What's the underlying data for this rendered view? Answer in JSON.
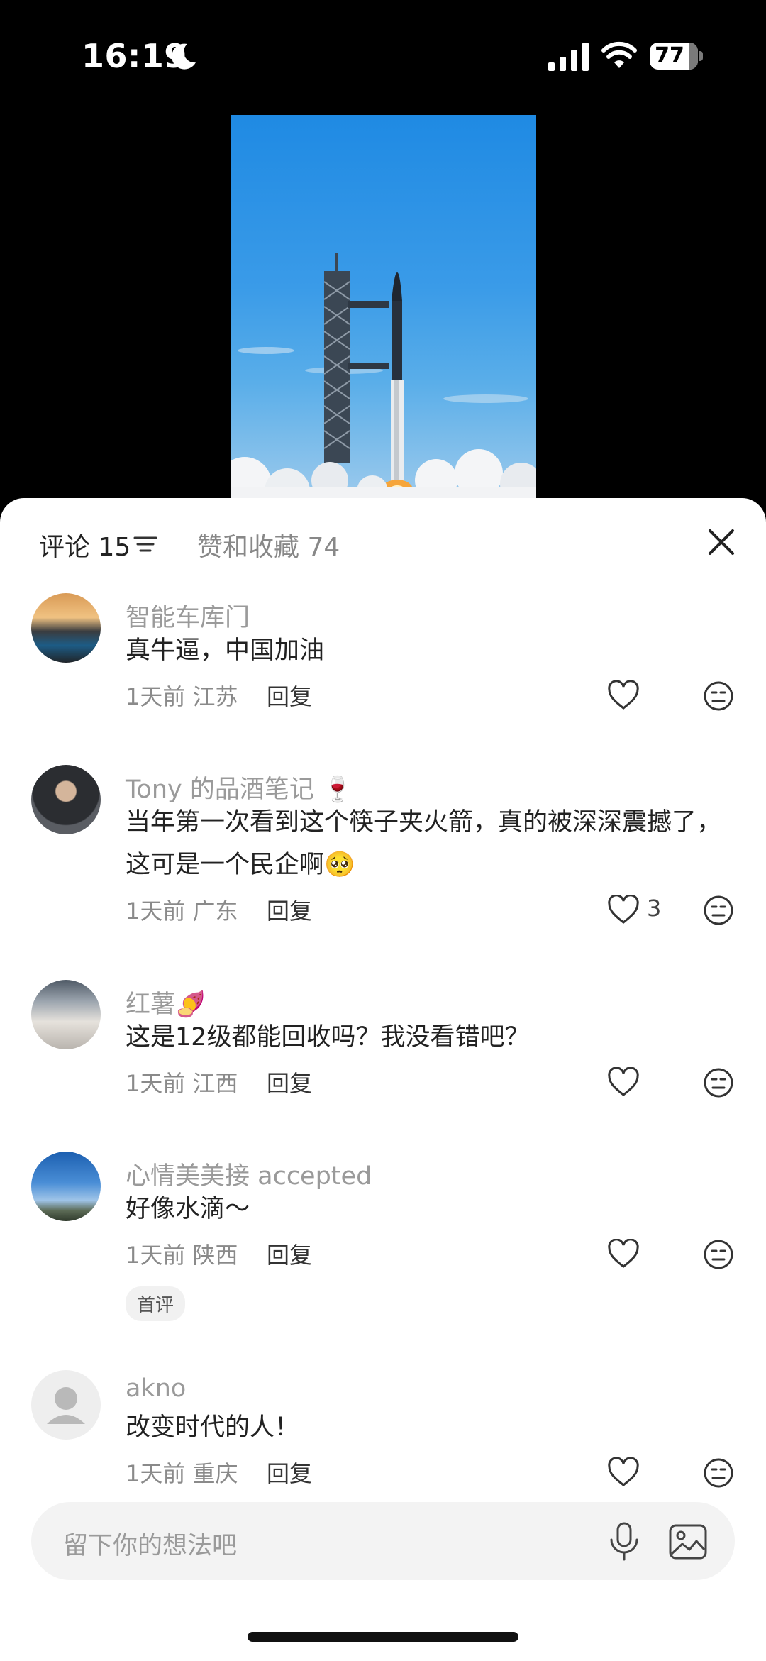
{
  "status_bar": {
    "time": "16:19",
    "battery": "77"
  },
  "tabs": {
    "comments": "评论 15",
    "likes": "赞和收藏 74"
  },
  "comments": [
    {
      "name": "智能车库门",
      "text": "真牛逼，中国加油",
      "time": "1天前",
      "region": "江苏",
      "reply": "回复"
    },
    {
      "name": "Tony 的品酒笔记 🍷",
      "text": "当年第一次看到这个筷子夹火箭，真的被深深震撼了，这可是一个民企啊🥺",
      "time": "1天前",
      "region": "广东",
      "reply": "回复",
      "likes": "3"
    },
    {
      "name": "红薯🍠",
      "text": "这是12级都能回收吗？我没看错吧？",
      "time": "1天前",
      "region": "江西",
      "reply": "回复"
    },
    {
      "name": "心情美美接 accepted",
      "text": "好像水滴～",
      "time": "1天前",
      "region": "陕西",
      "reply": "回复",
      "badge": "首评"
    },
    {
      "name": "akno",
      "text": "改变时代的人！",
      "time": "1天前",
      "region": "重庆",
      "reply": "回复"
    }
  ],
  "input": {
    "placeholder": "留下你的想法吧"
  }
}
